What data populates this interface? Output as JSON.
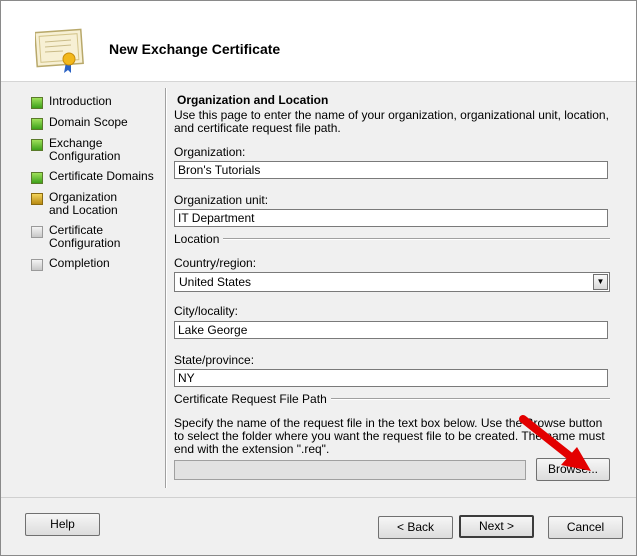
{
  "window": {
    "title": "New Exchange Certificate"
  },
  "icons": {
    "header": "certificate-icon",
    "pointer": "red-arrow-annotation"
  },
  "nav": {
    "items": [
      {
        "label": "Introduction",
        "state": "complete"
      },
      {
        "label": "Domain Scope",
        "state": "complete"
      },
      {
        "label": "Exchange Configuration",
        "state": "complete"
      },
      {
        "label": "Certificate Domains",
        "state": "complete"
      },
      {
        "label": "Organization and Location",
        "state": "current"
      },
      {
        "label": "Certificate Configuration",
        "state": "pending"
      },
      {
        "label": "Completion",
        "state": "pending"
      }
    ]
  },
  "page": {
    "heading": "Organization and Location",
    "description": "Use this page to enter the name of your organization, organizational unit, location, and certificate request file path."
  },
  "fields": {
    "organization": {
      "label": "Organization:",
      "value": "Bron's Tutorials"
    },
    "org_unit": {
      "label": "Organization unit:",
      "value": "IT Department"
    },
    "location_group": "Location",
    "country": {
      "label": "Country/region:",
      "value": "United States"
    },
    "city": {
      "label": "City/locality:",
      "value": "Lake George"
    },
    "state": {
      "label": "State/province:",
      "value": "NY"
    },
    "request_group": "Certificate Request File Path",
    "request_desc": "Specify the name of the request file in the text box below. Use the Browse button to select the folder where you want the request file to be created. The name must end with the extension \".req\".",
    "request_path": ""
  },
  "buttons": {
    "browse": "Browse...",
    "help": "Help",
    "back": "< Back",
    "next": "Next >",
    "cancel": "Cancel"
  },
  "colors": {
    "complete": "#3da11a",
    "current": "#b88a12",
    "pending": "#c8c8c8",
    "annotation": "#e30000"
  }
}
